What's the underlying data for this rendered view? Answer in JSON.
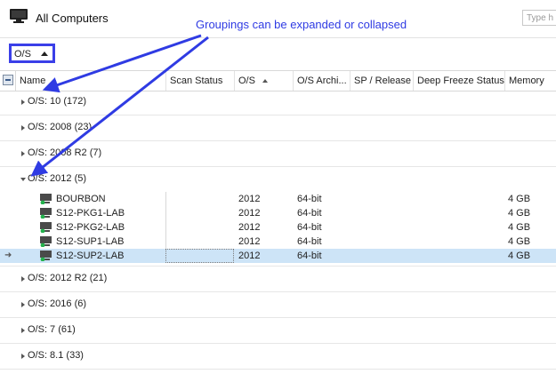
{
  "header": {
    "title": "All Computers",
    "search_placeholder": "Type h"
  },
  "grouping": {
    "chip_label": "O/S"
  },
  "annotation": {
    "text": "Groupings can be expanded or collapsed"
  },
  "columns": [
    "Name",
    "Scan Status",
    "O/S",
    "O/S Archi...",
    "SP / Release",
    "Deep Freeze Status",
    "Memory"
  ],
  "groups_before": [
    {
      "label": "O/S: 10   (172)"
    },
    {
      "label": "O/S: 2008   (23)"
    },
    {
      "label": "O/S: 2008 R2   (7)"
    }
  ],
  "expanded_group": {
    "label": "O/S: 2012   (5)",
    "rows": [
      {
        "name": "BOURBON",
        "os": "2012",
        "arch": "64-bit",
        "memory": "4 GB",
        "selected": false
      },
      {
        "name": "S12-PKG1-LAB",
        "os": "2012",
        "arch": "64-bit",
        "memory": "4 GB",
        "selected": false
      },
      {
        "name": "S12-PKG2-LAB",
        "os": "2012",
        "arch": "64-bit",
        "memory": "4 GB",
        "selected": false
      },
      {
        "name": "S12-SUP1-LAB",
        "os": "2012",
        "arch": "64-bit",
        "memory": "4 GB",
        "selected": false
      },
      {
        "name": "S12-SUP2-LAB",
        "os": "2012",
        "arch": "64-bit",
        "memory": "4 GB",
        "selected": true
      }
    ]
  },
  "groups_after": [
    {
      "label": "O/S: 2012 R2   (21)"
    },
    {
      "label": "O/S: 2016   (6)"
    },
    {
      "label": "O/S: 7   (61)"
    },
    {
      "label": "O/S: 8.1   (33)"
    }
  ],
  "colors": {
    "annotation": "#2f3be3",
    "selection": "#cde4f7"
  }
}
